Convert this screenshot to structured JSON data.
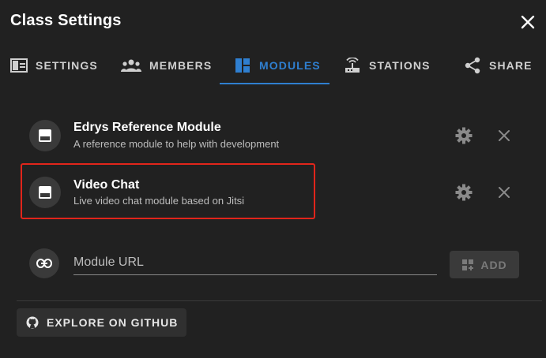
{
  "dialog": {
    "title": "Class Settings"
  },
  "tabs": [
    {
      "label": "SETTINGS",
      "icon": "settings-panel-icon",
      "active": false
    },
    {
      "label": "MEMBERS",
      "icon": "members-icon",
      "active": false
    },
    {
      "label": "MODULES",
      "icon": "modules-icon",
      "active": true
    },
    {
      "label": "STATIONS",
      "icon": "stations-icon",
      "active": false
    },
    {
      "label": "SHARE",
      "icon": "share-icon",
      "active": false
    }
  ],
  "modules": [
    {
      "title": "Edrys Reference Module",
      "subtitle": "A reference module to help with development"
    },
    {
      "title": "Video Chat",
      "subtitle": "Live video chat module based on Jitsi"
    }
  ],
  "module_url": {
    "placeholder": "Module URL",
    "value": ""
  },
  "add_button": {
    "label": "ADD"
  },
  "github_button": {
    "label": "EXPLORE ON GITHUB"
  },
  "colors": {
    "background": "#212121",
    "accent": "#2f7fd0",
    "highlight": "#e1251b"
  }
}
